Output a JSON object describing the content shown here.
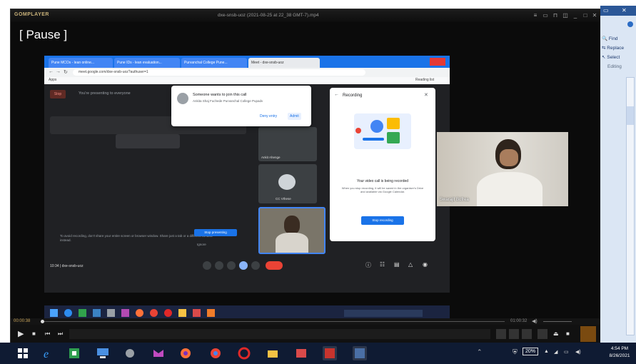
{
  "player": {
    "app_name": "GOMPLAYER",
    "file_title": "dxe-snsb-uoz (2021-08-25 at 22_38 GMT-7).mp4",
    "pause_label": "[ Pause ]",
    "time_elapsed": "00:00:38",
    "time_total": "01:00:32"
  },
  "browser": {
    "tabs": [
      "Pune MCOs - lean online...",
      "Pune IDs - lean evaluation...",
      "Purvanchal College Pune...",
      "Meet - dxe-snsb-uoz"
    ],
    "url": "meet.google.com/dxe-snsb-uoz?authuser=1",
    "bookmarks_label": "Apps",
    "reading_list": "Reading list"
  },
  "meet": {
    "presenting_label": "You're presenting to everyone",
    "stop_label": "Stop",
    "tile_names": [
      "Ankit Ahenge",
      "CC Vthese"
    ],
    "footer_meeting": "10:34 | dxe-snsb-uoz",
    "notice_text": "To avoid recording, don't share your entire screen or browser window. Share just a tab or a different window instead.",
    "stop_presenting": "Stop presenting",
    "ignore_label": "Ignore"
  },
  "join_popup": {
    "title": "Someone wants to join this call",
    "person": "Ankita Shaj Fuchede Purvanchal College Pupadv",
    "deny_label": "Deny entry",
    "admit_label": "Admit"
  },
  "recording_panel": {
    "title": "Recording",
    "message": "Your video call is being recorded",
    "detail": "When you stop recording, it will be saved in the organiser's Drive and available via Google Calendar.",
    "stop_button": "Stop recording"
  },
  "webcam": {
    "participant_name": "Swarajit Bofrea"
  },
  "office_panel": {
    "items": [
      "Find",
      "Replace",
      "Select",
      "Editing"
    ]
  },
  "taskbar": {
    "battery_percent": "20%",
    "clock_time": "4:54 PM",
    "clock_date": "8/26/2021"
  },
  "icons": [
    "windows-start-icon",
    "ie-icon",
    "office-icon",
    "monitor-icon",
    "mail-icon",
    "firefox-icon",
    "chrome-icon",
    "opera-icon",
    "folder-icon",
    "photo-icon",
    "notes-icon"
  ],
  "colors": {
    "accent_blue": "#1a73e8",
    "end_call_red": "#ea4335",
    "gom_gold": "#c9b27a"
  }
}
